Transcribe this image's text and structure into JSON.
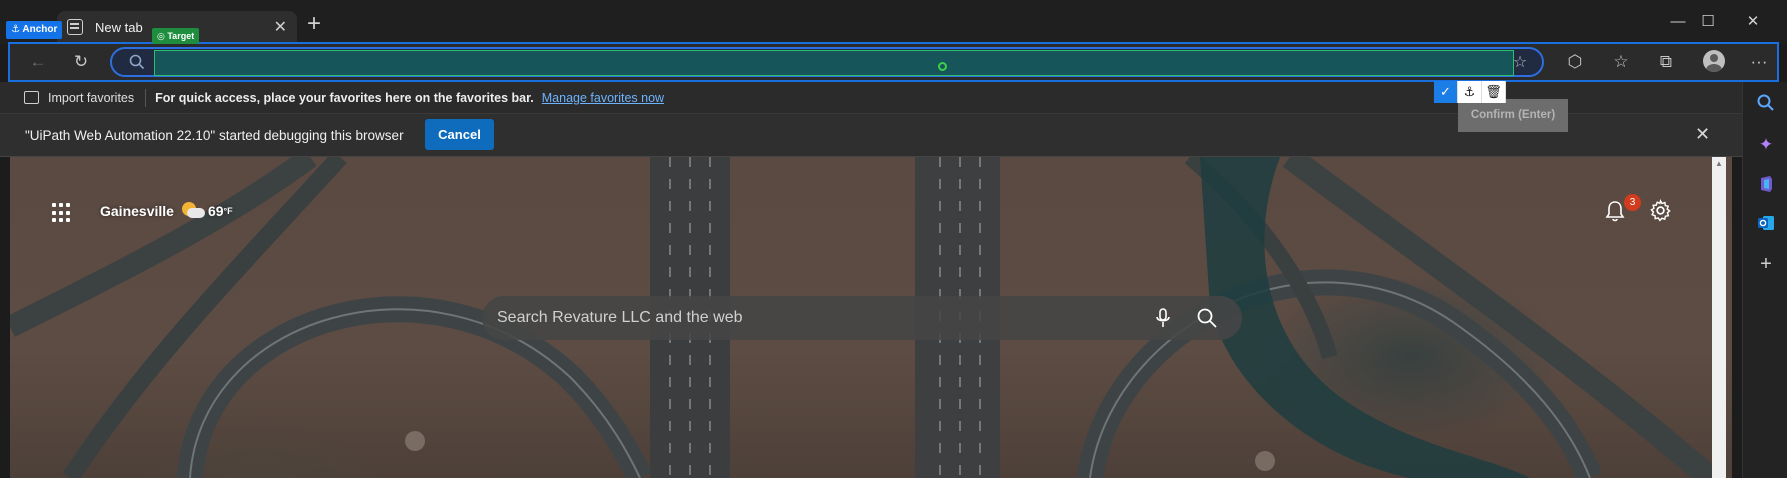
{
  "overlays": {
    "anchor_label": "⚓ Anchor",
    "target_label": "◎ Target",
    "confirm_tooltip": "Confirm (Enter)"
  },
  "tabs": [
    {
      "label": "New tab"
    }
  ],
  "window_controls": {
    "minimize": "—",
    "maximize": "☐",
    "close": "✕"
  },
  "toolbar": {
    "back_icon": "←",
    "refresh_icon": "↻",
    "address_value": "",
    "extensions_icon": "⬡",
    "favorites_icon": "☆",
    "collections_icon": "⧉",
    "menu_icon": "···"
  },
  "favorites_bar": {
    "import_label": "Import favorites",
    "message": "For quick access, place your favorites here on the favorites bar.",
    "manage_link": "Manage favorites now"
  },
  "infobar": {
    "message": "\"UiPath Web Automation 22.10\" started debugging this browser",
    "cancel_label": "Cancel"
  },
  "newtab": {
    "location": "Gainesville",
    "temperature": "69",
    "temp_unit": "°F",
    "notification_count": "3",
    "search_placeholder": "Search Revature LLC and the web"
  },
  "colors": {
    "accent": "#1a6fe0",
    "target_highlight": "#16555a",
    "cancel_button": "#0f6cbd",
    "badge": "#d13b1e"
  }
}
